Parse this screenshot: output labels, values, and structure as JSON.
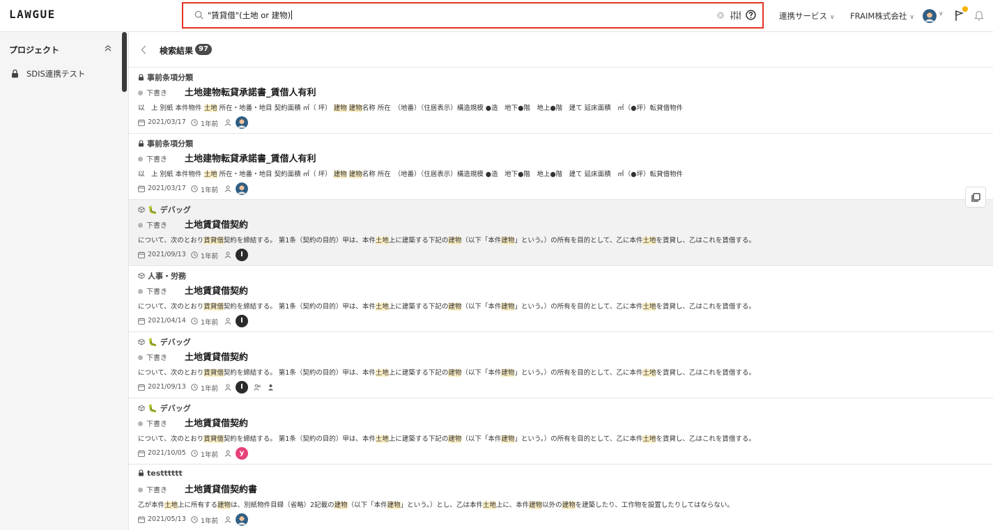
{
  "app": {
    "logo": "LAWGUE"
  },
  "search": {
    "value": "\"賃貸借\"(土地 or 建物)"
  },
  "header": {
    "integration_menu": "連携サービス",
    "company_menu": "FRAIM株式会社"
  },
  "sidebar": {
    "title": "プロジェクト",
    "projects": [
      {
        "label": "SDIS連携テスト"
      }
    ]
  },
  "results": {
    "title": "検索結果",
    "count": "97"
  },
  "colors": {
    "search_border": "#e53224",
    "highlight": "#fbeec3",
    "notification_dot": "#f4b400"
  },
  "items": [
    {
      "category": "事前条項分類",
      "category_icon": "lock-icon",
      "status": "下書き",
      "title": "土地建物転貸承諾書_賃借人有利",
      "snippet": [
        {
          "t": "以　上 別紙 本件物件 "
        },
        {
          "t": "土地",
          "h": true
        },
        {
          "t": " 所在・地番・地目 契約面積 ㎡（ 坪） "
        },
        {
          "t": "建物",
          "h": true
        },
        {
          "t": " "
        },
        {
          "t": "建物",
          "h": true
        },
        {
          "t": "名称 所在　（地番）（住居表示）構造規模 ●造　地下●階　地上●階　建て 延床面積　㎡（●坪）転貸借物件"
        }
      ],
      "date": "2021/03/17",
      "ago": "1年前",
      "avatar": "photo"
    },
    {
      "category": "事前条項分類",
      "category_icon": "lock-icon",
      "status": "下書き",
      "title": "土地建物転貸承諾書_賃借人有利",
      "snippet": [
        {
          "t": "以　上 別紙 本件物件 "
        },
        {
          "t": "土地",
          "h": true
        },
        {
          "t": " 所在・地番・地目 契約面積 ㎡（ 坪） "
        },
        {
          "t": "建物",
          "h": true
        },
        {
          "t": " "
        },
        {
          "t": "建物",
          "h": true
        },
        {
          "t": "名称 所在　（地番）（住居表示）構造規模 ●造　地下●階　地上●階　建て 延床面積　㎡（●坪）転貸借物件"
        }
      ],
      "date": "2021/03/17",
      "ago": "1年前",
      "avatar": "photo"
    },
    {
      "category": "デバッグ",
      "category_icon": "cube-icon",
      "emoji": "🐛",
      "status": "下書き",
      "title": "土地賃貸借契約",
      "highlighted": true,
      "snippet": [
        {
          "t": "について、次のとおり"
        },
        {
          "t": "賃貸借",
          "h": true
        },
        {
          "t": "契約を締結する。 第1条（契約の目的）甲は、本件"
        },
        {
          "t": "土地",
          "h": true
        },
        {
          "t": "上に建築する下記の"
        },
        {
          "t": "建物",
          "h": true
        },
        {
          "t": "（以下「本件"
        },
        {
          "t": "建物",
          "h": true
        },
        {
          "t": "」という。）の所有を目的として、乙に本件"
        },
        {
          "t": "土地",
          "h": true
        },
        {
          "t": "を賃貸し、乙はこれを賃借する。"
        }
      ],
      "date": "2021/09/13",
      "ago": "1年前",
      "avatar": "I",
      "avatar_color": "#2b2b2b"
    },
    {
      "category": "人事・労務",
      "category_icon": "cube-icon",
      "status": "下書き",
      "title": "土地賃貸借契約",
      "snippet": [
        {
          "t": "について、次のとおり"
        },
        {
          "t": "賃貸借",
          "h": true
        },
        {
          "t": "契約を締結する。 第1条（契約の目的）甲は、本件"
        },
        {
          "t": "土地",
          "h": true
        },
        {
          "t": "上に建築する下記の"
        },
        {
          "t": "建物",
          "h": true
        },
        {
          "t": "（以下「本件"
        },
        {
          "t": "建物",
          "h": true
        },
        {
          "t": "」という。）の所有を目的として、乙に本件"
        },
        {
          "t": "土地",
          "h": true
        },
        {
          "t": "を賃貸し、乙はこれを賃借する。"
        }
      ],
      "date": "2021/04/14",
      "ago": "1年前",
      "avatar": "I",
      "avatar_color": "#2b2b2b"
    },
    {
      "category": "デバッグ",
      "category_icon": "cube-icon",
      "emoji": "🐛",
      "status": "下書き",
      "title": "土地賃貸借契約",
      "snippet": [
        {
          "t": "について、次のとおり"
        },
        {
          "t": "賃貸借",
          "h": true
        },
        {
          "t": "契約を締結する。 第1条（契約の目的）甲は、本件"
        },
        {
          "t": "土地",
          "h": true
        },
        {
          "t": "上に建築する下記の"
        },
        {
          "t": "建物",
          "h": true
        },
        {
          "t": "（以下「本件"
        },
        {
          "t": "建物",
          "h": true
        },
        {
          "t": "」という。）の所有を目的として、乙に本件"
        },
        {
          "t": "土地",
          "h": true
        },
        {
          "t": "を賃貸し、乙はこれを賃借する。"
        }
      ],
      "date": "2021/09/13",
      "ago": "1年前",
      "avatar": "I",
      "avatar_color": "#2b2b2b",
      "extra_people": true
    },
    {
      "category": "デバッグ",
      "category_icon": "cube-icon",
      "emoji": "🐛",
      "status": "下書き",
      "title": "土地賃貸借契約",
      "snippet": [
        {
          "t": "について、次のとおり"
        },
        {
          "t": "賃貸借",
          "h": true
        },
        {
          "t": "契約を締結する。 第1条（契約の目的）甲は、本件"
        },
        {
          "t": "土地",
          "h": true
        },
        {
          "t": "上に建築する下記の"
        },
        {
          "t": "建物",
          "h": true
        },
        {
          "t": "（以下「本件"
        },
        {
          "t": "建物",
          "h": true
        },
        {
          "t": "」という。）の所有を目的として、乙に本件"
        },
        {
          "t": "土地",
          "h": true
        },
        {
          "t": "を賃貸し、乙はこれを賃借する。"
        }
      ],
      "date": "2021/10/05",
      "ago": "1年前",
      "avatar": "y",
      "avatar_color": "#e8417a"
    },
    {
      "category": "testttttt",
      "category_icon": "lock-icon",
      "status": "下書き",
      "title": "土地賃貸借契約書",
      "snippet": [
        {
          "t": "乙が本件"
        },
        {
          "t": "土地",
          "h": true
        },
        {
          "t": "上に所有する"
        },
        {
          "t": "建物",
          "h": true
        },
        {
          "t": "は、別紙物件目録（省略）2記載の"
        },
        {
          "t": "建物",
          "h": true
        },
        {
          "t": "（以下「本件"
        },
        {
          "t": "建物",
          "h": true
        },
        {
          "t": "」という。）とし、乙は本件"
        },
        {
          "t": "土地",
          "h": true
        },
        {
          "t": "上に、本件"
        },
        {
          "t": "建物",
          "h": true
        },
        {
          "t": "以外の"
        },
        {
          "t": "建物",
          "h": true
        },
        {
          "t": "を建築したり、工作物を設置したりしてはならない。"
        }
      ],
      "date": "2021/05/13",
      "ago": "1年前",
      "avatar": "photo"
    }
  ]
}
